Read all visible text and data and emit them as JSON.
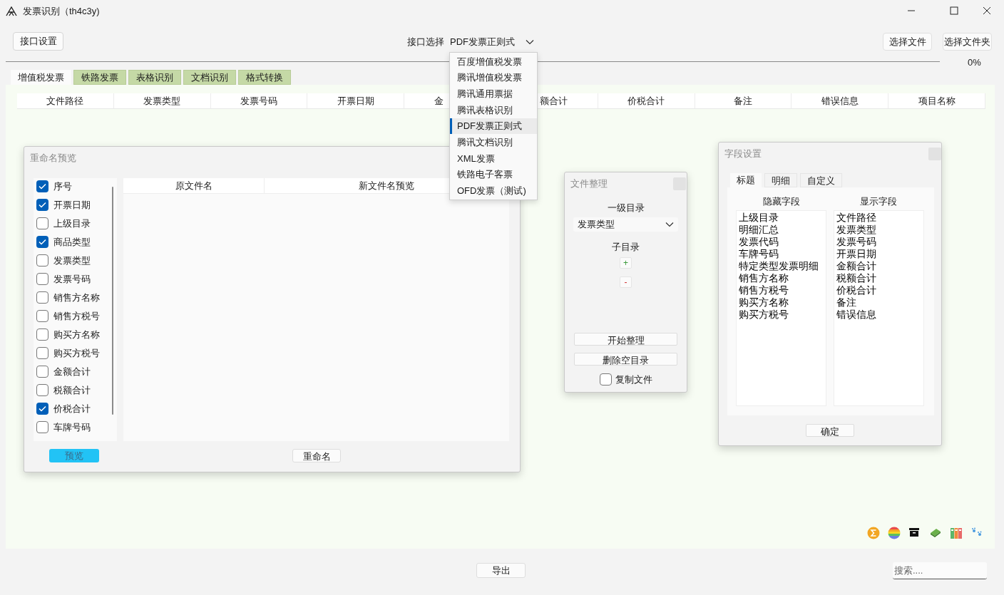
{
  "window": {
    "title": "发票识别（th4c3y)"
  },
  "toolbar": {
    "settings_button": "接口设置",
    "api_label": "接口选择",
    "api_select": {
      "value": "PDF发票正则式",
      "expanded": true,
      "options": [
        {
          "label": "百度增值税发票",
          "selected": false
        },
        {
          "label": "腾讯增值税发票",
          "selected": false
        },
        {
          "label": "腾讯通用票据",
          "selected": false
        },
        {
          "label": "腾讯表格识别",
          "selected": false
        },
        {
          "label": "PDF发票正则式",
          "selected": true
        },
        {
          "label": "腾讯文档识别",
          "selected": false
        },
        {
          "label": "XML发票",
          "selected": false
        },
        {
          "label": "铁路电子客票",
          "selected": false
        },
        {
          "label": "OFD发票（测试)",
          "selected": false
        }
      ]
    },
    "buttons": [
      "选择文件",
      "选择文件夹"
    ]
  },
  "progress": {
    "level": 0,
    "reading": "0%"
  },
  "tabs": [
    {
      "label": "增值税发票",
      "selected": true
    },
    {
      "label": "铁路发票",
      "selected": false
    },
    {
      "label": "表格识别",
      "selected": false
    },
    {
      "label": "文档识别",
      "selected": false
    },
    {
      "label": "格式转换",
      "selected": false
    }
  ],
  "table": {
    "columns": [
      {
        "label": "文件路径"
      },
      {
        "label": "发票类型"
      },
      {
        "label": "发票号码"
      },
      {
        "label": "开票日期"
      },
      {
        "label": "金",
        "kind": "headpart"
      },
      {
        "label": "额合计",
        "kind": "tailpart"
      },
      {
        "label": "价税合计"
      },
      {
        "label": "备注"
      },
      {
        "label": "错误信息"
      },
      {
        "label": "项目名称"
      }
    ]
  },
  "rename_panel": {
    "title": "重命名预览",
    "fields": [
      {
        "label": "序号",
        "checked": true
      },
      {
        "label": "开票日期",
        "checked": true
      },
      {
        "label": "上级目录",
        "checked": false
      },
      {
        "label": "商品类型",
        "checked": true
      },
      {
        "label": "发票类型",
        "checked": false
      },
      {
        "label": "发票号码",
        "checked": false
      },
      {
        "label": "销售方名称",
        "checked": false
      },
      {
        "label": "销售方税号",
        "checked": false
      },
      {
        "label": "购买方名称",
        "checked": false
      },
      {
        "label": "购买方税号",
        "checked": false
      },
      {
        "label": "金额合计",
        "checked": false
      },
      {
        "label": "税额合计",
        "checked": false
      },
      {
        "label": "价税合计",
        "checked": true
      },
      {
        "label": "车牌号码",
        "checked": false
      }
    ],
    "columns": [
      "原文件名",
      "新文件名预览"
    ],
    "buttons": [
      {
        "label": "预览",
        "kind": "primary"
      },
      {
        "label": "重命名",
        "kind": "default"
      }
    ]
  },
  "organize_panel": {
    "title": "文件整理",
    "level1_label": "一级目录",
    "level1_select": "发票类型",
    "sub_label": "子目录",
    "add_button": "+",
    "remove_button": "-",
    "buttons": [
      "开始整理",
      "删除空目录"
    ],
    "copy_files": {
      "label": "复制文件",
      "checked": false
    }
  },
  "field_panel": {
    "title": "字段设置",
    "tabs": [
      {
        "label": "标题",
        "selected": true
      },
      {
        "label": "明细",
        "selected": false
      },
      {
        "label": "自定义",
        "selected": false
      }
    ],
    "hidden_label": "隐藏字段",
    "shown_label": "显示字段",
    "hidden_fields": [
      "上级目录",
      "明细汇总",
      "发票代码",
      "车牌号码",
      "特定类型发票明细",
      "销售方名称",
      "销售方税号",
      "购买方名称",
      "购买方税号"
    ],
    "shown_fields": [
      "文件路径",
      "发票类型",
      "发票号码",
      "开票日期",
      "金额合计",
      "税额合计",
      "价税合计",
      "备注",
      "错误信息"
    ],
    "ok_button": "确定"
  },
  "export_button": "导出",
  "search": {
    "placeholder": "搜索...."
  }
}
